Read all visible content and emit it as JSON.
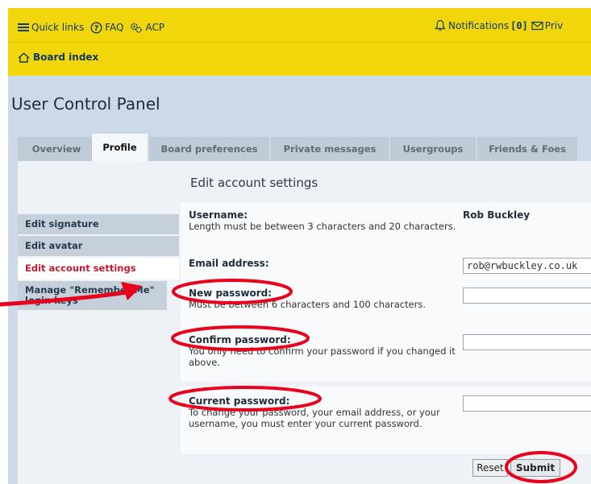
{
  "topnav": {
    "quick_links": "Quick links",
    "faq": "FAQ",
    "acp": "ACP",
    "notifications_label": "Notifications",
    "notifications_count": "[0]",
    "private_messages": "Priv"
  },
  "breadcrumb": {
    "board_index": "Board index"
  },
  "page_title": "User Control Panel",
  "tabs": [
    {
      "label": "Overview"
    },
    {
      "label": "Profile",
      "active": true
    },
    {
      "label": "Board preferences"
    },
    {
      "label": "Private messages"
    },
    {
      "label": "Usergroups"
    },
    {
      "label": "Friends & Foes"
    }
  ],
  "sidebar": {
    "items": [
      {
        "label": "Edit signature"
      },
      {
        "label": "Edit avatar"
      },
      {
        "label": "Edit account settings",
        "active": true
      },
      {
        "label": "Manage \"Remember Me\" login keys"
      }
    ]
  },
  "form": {
    "section_title": "Edit account settings",
    "username_label": "Username:",
    "username_explain": "Length must be between 3 characters and 20 characters.",
    "username_value": "Rob Buckley",
    "email_label": "Email address:",
    "email_value": "rob@rwbuckley.co.uk",
    "new_password_label": "New password:",
    "new_password_explain": "Must be between 6 characters and 100 characters.",
    "confirm_password_label": "Confirm password:",
    "confirm_password_explain": "You only need to confirm your password if you changed it above.",
    "current_password_label": "Current password:",
    "current_password_explain": "To change your password, your email address, or your username, you must enter your current password.",
    "reset_label": "Reset",
    "submit_label": "Submit"
  },
  "colors": {
    "header_yellow": "#f1d60b",
    "annotation_red": "#e8001c",
    "active_menu_text": "#c7182d"
  }
}
